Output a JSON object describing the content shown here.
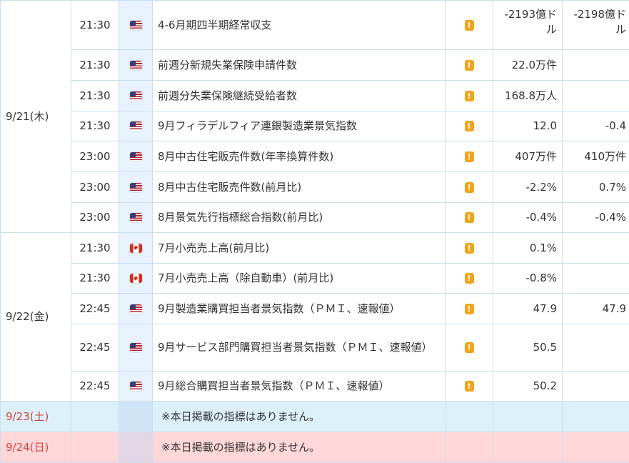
{
  "calendar": {
    "days": [
      {
        "date": "9/21(木)",
        "rows": [
          {
            "time": "21:30",
            "country": "US",
            "flag_icon": "us-flag-icon",
            "name": "4-6月期四半期経常収支",
            "importance_icon": "exclamation-icon",
            "previous": "-2193億ドル",
            "forecast": "-2198億ドル"
          },
          {
            "time": "21:30",
            "country": "US",
            "flag_icon": "us-flag-icon",
            "name": "前週分新規失業保険申請件数",
            "importance_icon": "exclamation-icon",
            "previous": "22.0万件",
            "forecast": ""
          },
          {
            "time": "21:30",
            "country": "US",
            "flag_icon": "us-flag-icon",
            "name": "前週分失業保険継続受給者数",
            "importance_icon": "exclamation-icon",
            "previous": "168.8万人",
            "forecast": ""
          },
          {
            "time": "21:30",
            "country": "US",
            "flag_icon": "us-flag-icon",
            "name": "9月フィラデルフィア連銀製造業景気指数",
            "importance_icon": "exclamation-icon",
            "previous": "12.0",
            "forecast": "-0.4"
          },
          {
            "time": "23:00",
            "country": "US",
            "flag_icon": "us-flag-icon",
            "name": "8月中古住宅販売件数(年率換算件数)",
            "importance_icon": "exclamation-icon",
            "previous": "407万件",
            "forecast": "410万件"
          },
          {
            "time": "23:00",
            "country": "US",
            "flag_icon": "us-flag-icon",
            "name": "8月中古住宅販売件数(前月比)",
            "importance_icon": "exclamation-icon",
            "previous": "-2.2%",
            "forecast": "0.7%"
          },
          {
            "time": "23:00",
            "country": "US",
            "flag_icon": "us-flag-icon",
            "name": "8月景気先行指標総合指数(前月比)",
            "importance_icon": "exclamation-icon",
            "previous": "-0.4%",
            "forecast": "-0.4%"
          }
        ]
      },
      {
        "date": "9/22(金)",
        "rows": [
          {
            "time": "21:30",
            "country": "CA",
            "flag_icon": "canada-flag-icon",
            "name": "7月小売売上高(前月比)",
            "importance_icon": "exclamation-icon",
            "previous": "0.1%",
            "forecast": ""
          },
          {
            "time": "21:30",
            "country": "CA",
            "flag_icon": "canada-flag-icon",
            "name": "7月小売売上高（除自動車）(前月比)",
            "importance_icon": "exclamation-icon",
            "previous": "-0.8%",
            "forecast": ""
          },
          {
            "time": "22:45",
            "country": "US",
            "flag_icon": "us-flag-icon",
            "name": "9月製造業購買担当者景気指数（ＰＭＩ、速報値）",
            "importance_icon": "exclamation-icon",
            "previous": "47.9",
            "forecast": "47.9"
          },
          {
            "time": "22:45",
            "country": "US",
            "flag_icon": "us-flag-icon",
            "name": "9月サービス部門購買担当者景気指数（ＰＭＩ、速報値）",
            "importance_icon": "exclamation-icon",
            "previous": "50.5",
            "forecast": ""
          },
          {
            "time": "22:45",
            "country": "US",
            "flag_icon": "us-flag-icon",
            "name": "9月総合購買担当者景気指数（ＰＭＩ、速報値）",
            "importance_icon": "exclamation-icon",
            "previous": "50.2",
            "forecast": ""
          }
        ]
      }
    ],
    "empty_days": [
      {
        "date": "9/23(土)",
        "message": "※本日掲載の指標はありません。",
        "kind": "saturday",
        "background": "#dcf0fa"
      },
      {
        "date": "9/24(日)",
        "message": "※本日掲載の指標はありません。",
        "kind": "sunday",
        "background": "#ffd7d9"
      }
    ],
    "importance_mark": "!"
  },
  "colors": {
    "border": "#c9dff0",
    "flag_column": "#e8f2fc",
    "importance": "#f0a51c",
    "weekend_date_text": "#d6453d"
  }
}
